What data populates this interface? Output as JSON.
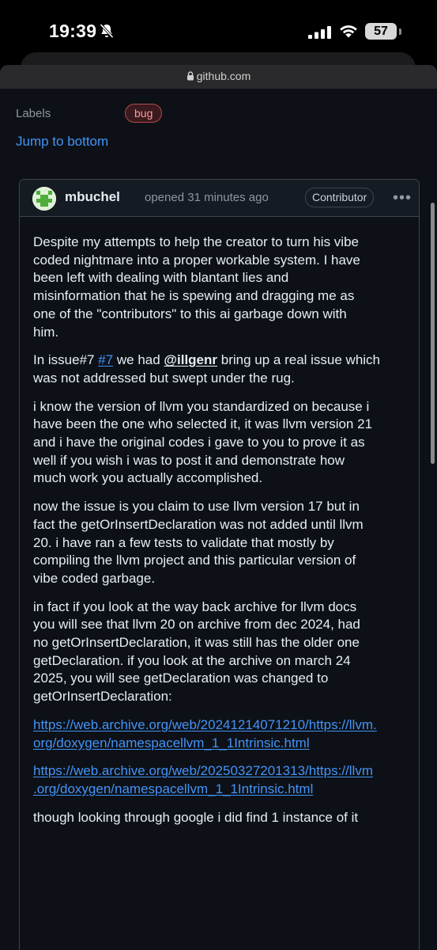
{
  "status_bar": {
    "time": "19:39",
    "battery": "57"
  },
  "browser": {
    "url": "github.com"
  },
  "sidebar": {
    "labels_label": "Labels",
    "label_bug": "bug",
    "jump_link": "Jump to bottom"
  },
  "comment": {
    "author": "mbuchel",
    "opened": "opened 31 minutes ago",
    "badge": "Contributor",
    "more": "•••",
    "p1": [
      "Despite my attempts to help the creator to turn his vibe",
      "coded nightmare into a proper workable system. I have",
      "been left with dealing with blantant lies and",
      "misinformation that he is spewing and dragging me as",
      "one of the \"contributors\" to this ai garbage down with",
      "him."
    ],
    "p2": {
      "pre": "In issue#7 ",
      "issue_ref": "#7",
      "mid": " we had ",
      "mention": "@illgenr",
      "post": " bring up a real issue which",
      "line2": "was not addressed but swept under the rug."
    },
    "p3": [
      "i know the version of llvm you standardized on because i",
      "have been the one who selected it, it was llvm version 21",
      "and i have the original codes i gave to you to prove it as",
      "well if you wish i was to post it and demonstrate how",
      "much work you actually accomplished."
    ],
    "p4": [
      "now the issue is you claim to use llvm version 17 but in",
      "fact the getOrInsertDeclaration was not added until llvm",
      "20. i have ran a few tests to validate that mostly by",
      "compiling the llvm project and this particular version of",
      "vibe coded garbage."
    ],
    "p5": [
      "in fact if you look at the way back archive for llvm docs",
      "you will see that llvm 20 on archive from dec 2024, had",
      "no getOrInsertDeclaration, it was still has the older one",
      "getDeclaration. if you look at the archive on march 24",
      "2025, you will see getDeclaration was changed to",
      "getOrInsertDeclaration:"
    ],
    "link1": [
      "https://web.archive.org/web/20241214071210/https://llvm.",
      "org/doxygen/namespacellvm_1_1Intrinsic.html"
    ],
    "link2": [
      "https://web.archive.org/web/20250327201313/https://llvm",
      ".org/doxygen/namespacellvm_1_1Intrinsic.html"
    ],
    "p6": "though looking through google i did find 1 instance of it"
  }
}
